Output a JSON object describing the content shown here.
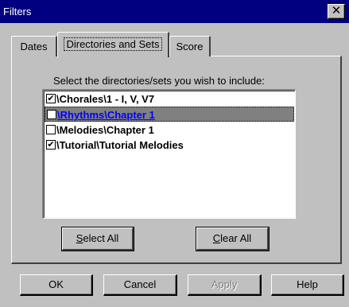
{
  "window": {
    "title": "Filters",
    "close_glyph": "✕"
  },
  "tabs": [
    {
      "label": "Dates"
    },
    {
      "label": "Directories and Sets"
    },
    {
      "label": "Score"
    }
  ],
  "panel": {
    "instruction": "Select the directories/sets you wish to include:",
    "items": [
      {
        "label": "\\Chorales\\1 - I, V, V7",
        "checked": true,
        "check": "✔"
      },
      {
        "label": "\\Rhythms\\Chapter 1",
        "checked": false,
        "check": ""
      },
      {
        "label": "\\Melodies\\Chapter 1",
        "checked": false,
        "check": ""
      },
      {
        "label": "\\Tutorial\\Tutorial Melodies",
        "checked": true,
        "check": "✔"
      }
    ],
    "select_all": {
      "mnemonic": "S",
      "rest": "elect All"
    },
    "clear_all": {
      "mnemonic": "C",
      "rest": "lear All"
    }
  },
  "footer": {
    "ok": "OK",
    "cancel": "Cancel",
    "apply": "Apply",
    "help": "Help"
  },
  "colors": {
    "titlebar": "#000080",
    "face": "#c0c0c0",
    "selection": "#808080",
    "link_text": "#0000ff"
  }
}
